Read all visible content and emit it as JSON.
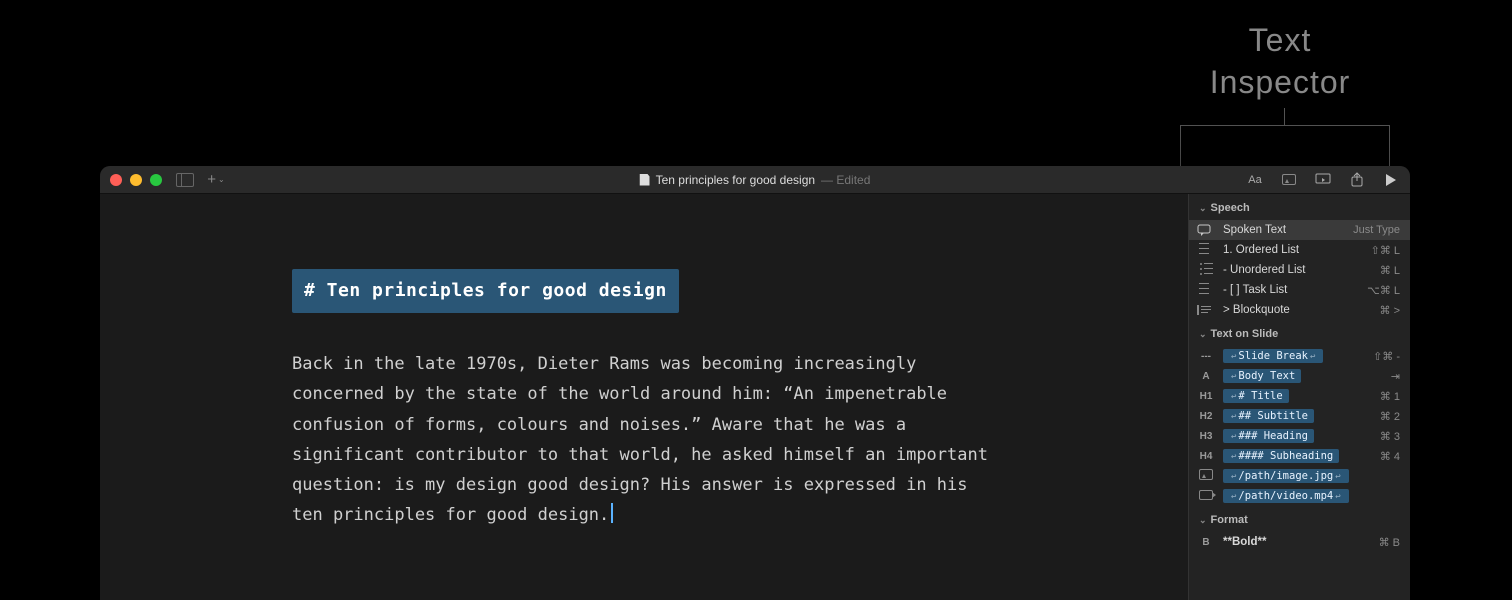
{
  "annotation": {
    "line1": "Text",
    "line2": "Inspector"
  },
  "window": {
    "title": "Ten principles for good design",
    "status": "— Edited",
    "toolbar_right": {
      "Aa": "Aa"
    }
  },
  "editor": {
    "heading": "# Ten principles for good design",
    "body": "Back in the late 1970s, Dieter Rams was becoming increasingly concerned by the state of the world around him: “An impenetrable confusion of forms, colours and noises.” Aware that he was a significant contributor to that world, he asked himself an important question: is my design good design? His answer is expressed in his ten principles for good design."
  },
  "inspector": {
    "sections": {
      "speech": {
        "title": "Speech",
        "items": [
          {
            "glyph_name": "speech-bubble-icon",
            "label": "Spoken Text",
            "shortcut": "Just Type",
            "selected": true
          },
          {
            "glyph_name": "ordered-list-icon",
            "label": "1. Ordered List",
            "shortcut": "⇧⌘ L"
          },
          {
            "glyph_name": "unordered-list-icon",
            "label": "- Unordered List",
            "shortcut": "⌘ L"
          },
          {
            "glyph_name": "task-list-icon",
            "label": "- [ ] Task List",
            "shortcut": "⌥⌘ L"
          },
          {
            "glyph_name": "blockquote-icon",
            "label": "> Blockquote",
            "shortcut": "⌘ >"
          }
        ]
      },
      "text_on_slide": {
        "title": "Text on Slide",
        "items": [
          {
            "glyph": "---",
            "glyph_name": "hr-icon",
            "pill_label": "Slide Break",
            "pill_prefix_rtn": true,
            "pill_suffix_rtn": true,
            "shortcut": "⇧⌘ -"
          },
          {
            "glyph": "A",
            "glyph_name": "body-text-icon",
            "pill_label": "Body Text",
            "pill_prefix_rtn": true,
            "shortcut": "⇥"
          },
          {
            "glyph": "H1",
            "glyph_name": "h1-icon",
            "pill_label": "# Title",
            "pill_prefix_rtn": true,
            "shortcut": "⌘ 1"
          },
          {
            "glyph": "H2",
            "glyph_name": "h2-icon",
            "pill_label": "## Subtitle",
            "pill_prefix_rtn": true,
            "shortcut": "⌘ 2"
          },
          {
            "glyph": "H3",
            "glyph_name": "h3-icon",
            "pill_label": "### Heading",
            "pill_prefix_rtn": true,
            "shortcut": "⌘ 3"
          },
          {
            "glyph": "H4",
            "glyph_name": "h4-icon",
            "pill_label": "#### Subheading",
            "pill_prefix_rtn": true,
            "shortcut": "⌘ 4"
          },
          {
            "glyph_name": "image-icon",
            "pill_label": "/path/image.jpg",
            "pill_prefix_rtn": true,
            "pill_suffix_rtn": true,
            "shortcut": ""
          },
          {
            "glyph_name": "video-icon",
            "pill_label": "/path/video.mp4",
            "pill_prefix_rtn": true,
            "pill_suffix_rtn": true,
            "shortcut": ""
          }
        ]
      },
      "format": {
        "title": "Format",
        "items": [
          {
            "glyph": "B",
            "glyph_name": "bold-icon",
            "label": "**Bold**",
            "shortcut": "⌘ B"
          }
        ]
      }
    }
  }
}
